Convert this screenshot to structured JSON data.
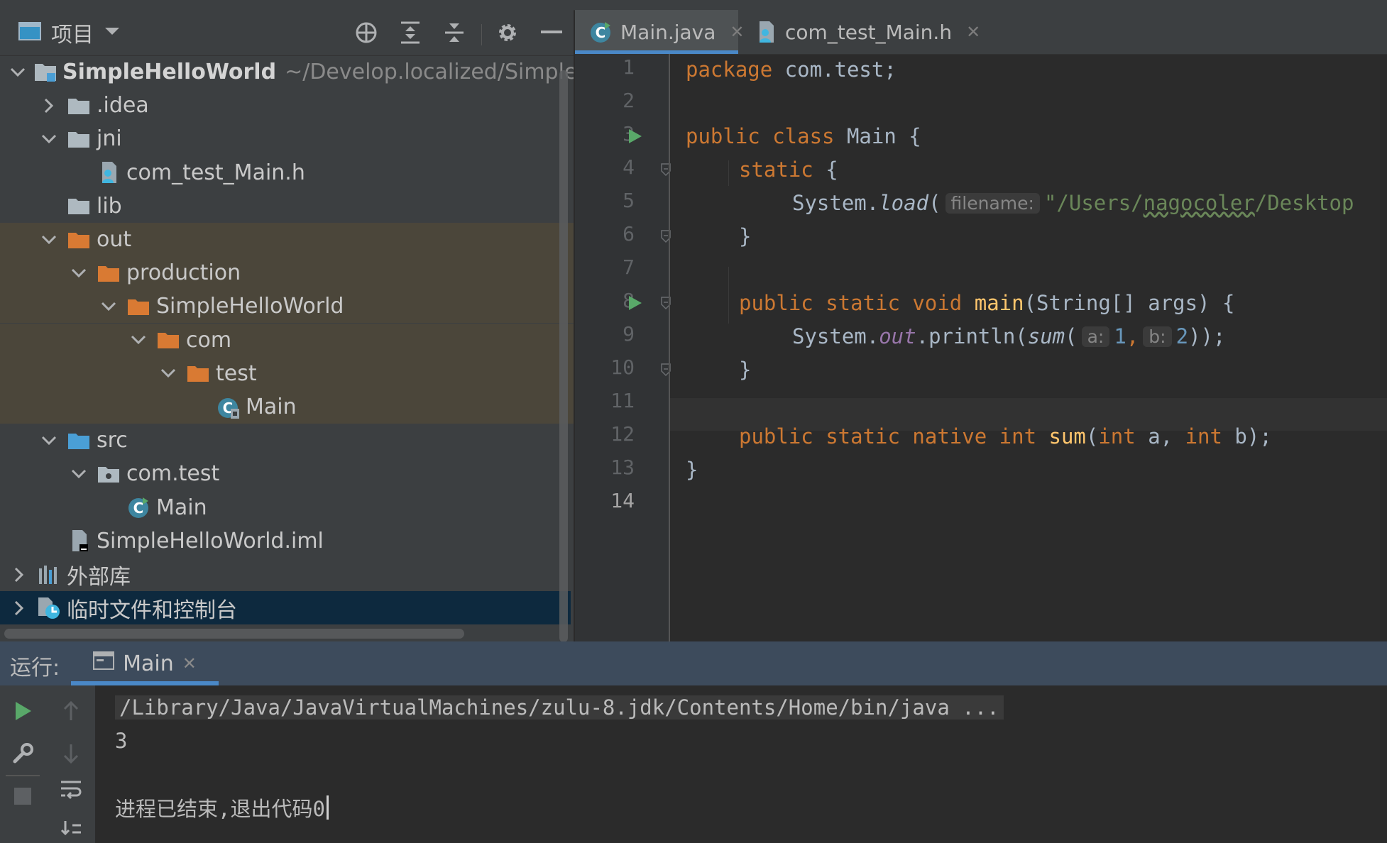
{
  "project": {
    "view_label": "项目",
    "tree": [
      {
        "label": "SimpleHelloWorld",
        "path": "~/Develop.localized/SimpleH",
        "icon": "module-folder-icon",
        "chevron": "down",
        "depth": 0,
        "bold": true
      },
      {
        "label": ".idea",
        "icon": "folder-icon",
        "chevron": "right",
        "depth": 1
      },
      {
        "label": "jni",
        "icon": "folder-icon",
        "chevron": "down",
        "depth": 1
      },
      {
        "label": "com_test_Main.h",
        "icon": "header-file-icon",
        "chevron": "",
        "depth": 2
      },
      {
        "label": "lib",
        "icon": "folder-icon",
        "chevron": "",
        "depth": 1
      },
      {
        "label": "out",
        "icon": "excluded-folder-icon",
        "chevron": "down",
        "depth": 1,
        "excluded": true
      },
      {
        "label": "production",
        "icon": "excluded-folder-icon",
        "chevron": "down",
        "depth": 2,
        "excluded": true
      },
      {
        "label": "SimpleHelloWorld",
        "icon": "excluded-folder-icon",
        "chevron": "down",
        "depth": 3,
        "excluded": true
      },
      {
        "label": "com",
        "icon": "excluded-folder-icon",
        "chevron": "down",
        "depth": 4,
        "excluded": true
      },
      {
        "label": "test",
        "icon": "excluded-folder-icon",
        "chevron": "down",
        "depth": 5,
        "excluded": true
      },
      {
        "label": "Main",
        "icon": "compiled-class-icon",
        "chevron": "",
        "depth": 6,
        "excluded": true
      },
      {
        "label": "src",
        "icon": "source-folder-icon",
        "chevron": "down",
        "depth": 1
      },
      {
        "label": "com.test",
        "icon": "package-icon",
        "chevron": "down",
        "depth": 2
      },
      {
        "label": "Main",
        "icon": "java-class-icon",
        "chevron": "",
        "depth": 3
      },
      {
        "label": "SimpleHelloWorld.iml",
        "icon": "iml-file-icon",
        "chevron": "",
        "depth": 1
      },
      {
        "label": "外部库",
        "icon": "libraries-icon",
        "chevron": "right",
        "depth": 0
      },
      {
        "label": "临时文件和控制台",
        "icon": "scratches-icon",
        "chevron": "right",
        "depth": 0,
        "selected": true
      }
    ]
  },
  "editor": {
    "tabs": [
      {
        "label": "Main.java",
        "icon": "java-class-icon",
        "active": true
      },
      {
        "label": "com_test_Main.h",
        "icon": "header-file-icon",
        "active": false
      }
    ],
    "line_numbers": [
      "1",
      "2",
      "3",
      "4",
      "5",
      "6",
      "7",
      "8",
      "9",
      "10",
      "11",
      "12",
      "13",
      "14"
    ],
    "current_line": 14,
    "code": {
      "l1_kw": "package",
      "l1_pkg": " com.test;",
      "l3_kw": "public class",
      "l3_rest": " Main {",
      "l4_kw": "static",
      "l4_rest": " {",
      "l5_a": "System.",
      "l5_call": "load",
      "l5_b": "(",
      "l5_hint": "filename:",
      "l5_str_a": "\"/Users/",
      "l5_str_typo": "nagocoler",
      "l5_str_b": "/Desktop",
      "l6": "}",
      "l8_kw": "public static void",
      "l8_fn": " main",
      "l8_rest": "(String[] args) {",
      "l9_a": "System.",
      "l9_field": "out",
      "l9_b": ".println(",
      "l9_call": "sum",
      "l9_c": "(",
      "l9_hint_a": "a:",
      "l9_num_a": "1",
      "l9_comma": ",",
      "l9_hint_b": "b:",
      "l9_num_b": "2",
      "l9_end": "));",
      "l10": "}",
      "l12_kw": "public static native int",
      "l12_fn": " sum",
      "l12_p1": "(",
      "l12_kw2": "int",
      "l12_p2": " a, ",
      "l12_kw3": "int",
      "l12_p3": " b);",
      "l13": "}"
    }
  },
  "run": {
    "title": "运行:",
    "tab_label": "Main",
    "console": {
      "command": "/Library/Java/JavaVirtualMachines/zulu-8.jdk/Contents/Home/bin/java ...",
      "output": "3",
      "exit_message": "进程已结束,退出代码0"
    }
  },
  "colors": {
    "keyword": "#cc7832",
    "function": "#ffc66d",
    "string": "#6a8759",
    "number": "#6897bb",
    "static_field": "#9876aa",
    "excluded_folder": "#d97a33",
    "accent": "#4a88c7"
  }
}
